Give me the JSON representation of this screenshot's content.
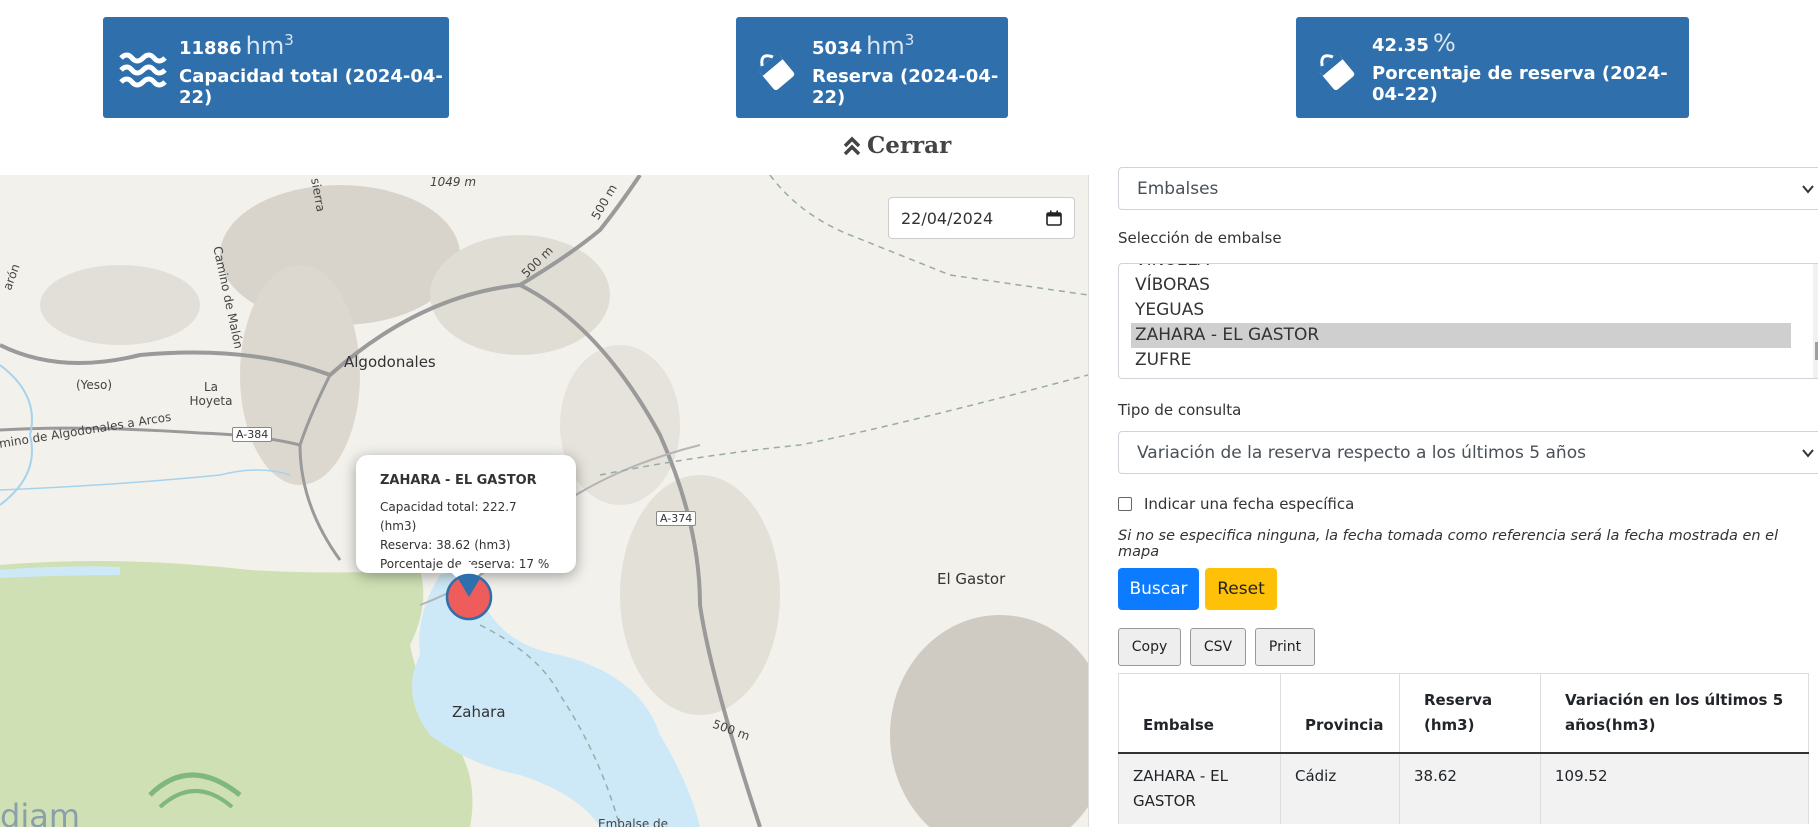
{
  "stats": {
    "capacity": {
      "value": "11886",
      "unit": "hm",
      "unit_sup": "3",
      "caption": "Capacidad total (2024-04-22)",
      "icon": "water-waves-icon"
    },
    "reserve": {
      "value": "5034",
      "unit": "hm",
      "unit_sup": "3",
      "caption": "Reserva (2024-04-22)",
      "icon": "bucket-fill-icon"
    },
    "percent": {
      "value": "42.35",
      "unit": "%",
      "caption": "Porcentaje de reserva (2024-04-22)",
      "icon": "bucket-fill-icon"
    }
  },
  "collapse": {
    "label": "Cerrar",
    "icon": "double-chevron-up-icon"
  },
  "map": {
    "date_value": "22/04/2024",
    "date_icon": "calendar-icon",
    "labels": {
      "algodonales": "Algodonales",
      "el_gastor": "El Gastor",
      "zahara": "Zahara",
      "la_hoyeta": "La Hoyeta",
      "yeso": "(Yeso)",
      "camino_algodonales": "mino de Algodonales a Arcos",
      "camino_malon": "Camino de Malón",
      "road_a384": "A-384",
      "road_a374": "A-374",
      "alt_1049": "1049 m",
      "alt_500a": "500 m",
      "alt_500b": "500 m",
      "alt_500c": "500 m",
      "sierra": "sierra",
      "aron": "arón",
      "embalse": "Embalse de",
      "logo_text": "diam"
    },
    "popup": {
      "title": "ZAHARA - EL GASTOR",
      "capacity": "Capacidad total: 222.7 (hm3)",
      "reserve": "Reserva: 38.62 (hm3)",
      "percent": "Porcentaje de reserva: 17 %",
      "marker_fill_percent": 17
    },
    "colors": {
      "water": "#cde9f7",
      "forest": "#cfe1b4",
      "marker": "#ee5c5c",
      "marker_border": "#2f6fab"
    }
  },
  "panel": {
    "type_select": {
      "value": "Embalses"
    },
    "reservoir_label": "Selección de embalse",
    "reservoir_options": [
      "VIÑUELA",
      "VÍBORAS",
      "YEGUAS",
      "ZAHARA - EL GASTOR",
      "ZUFRE"
    ],
    "selected_option": "ZAHARA - EL GASTOR",
    "query_label": "Tipo de consulta",
    "query_select": {
      "value": "Variación de la reserva respecto a los últimos 5 años"
    },
    "checkbox_label": "Indicar una fecha específica",
    "hint": "Si no se especifica ninguna, la fecha tomada como referencia será la fecha mostrada en el mapa",
    "search_button": "Buscar",
    "reset_button": "Reset",
    "export_buttons": [
      "Copy",
      "CSV",
      "Print"
    ],
    "table": {
      "headers": [
        "Embalse",
        "Provincia",
        "Reserva (hm3)",
        "Variación en los últimos 5 años(hm3)"
      ],
      "rows": [
        [
          "ZAHARA - EL GASTOR",
          "Cádiz",
          "38.62",
          "109.52"
        ]
      ]
    }
  }
}
